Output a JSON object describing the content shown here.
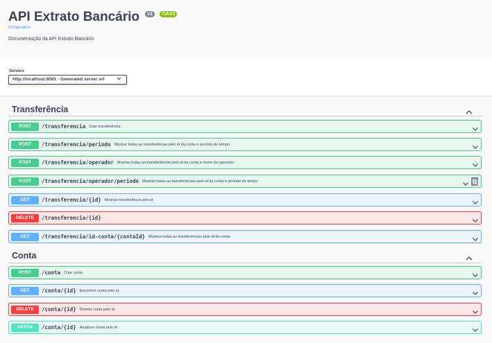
{
  "info": {
    "title": "API Extrato Bancário",
    "version_badge": "v1",
    "oas_badge": "OAS3",
    "docs_url": "/v3/api-docs",
    "description": "Documentação da API Extrato Bancário"
  },
  "servers": {
    "label": "Servers",
    "selected": "http://localhost:8081 - Generated server url"
  },
  "sections": [
    {
      "name": "Transferência",
      "operations": [
        {
          "method": "POST",
          "path": "/transferencia",
          "summary": "Criar transferência"
        },
        {
          "method": "POST",
          "path": "/transferencia/periodo",
          "summary": "Mostrar todas as transferências pelo id da conta e período de tempo"
        },
        {
          "method": "POST",
          "path": "/transferencia/operador",
          "summary": "Mostrar todas as transferências pelo id da conta e nome do operador"
        },
        {
          "method": "POST",
          "path": "/transferencia/operador/periodo",
          "summary": "Mostrar todas as transferências pelo id da conta e período de tempo"
        },
        {
          "method": "GET",
          "path": "/transferencia/{id}",
          "summary": "Mostrar transferência pelo id"
        },
        {
          "method": "DELETE",
          "path": "/transferencia/{id}",
          "summary": ""
        },
        {
          "method": "GET",
          "path": "/transferencia/id-conta/{contaId}",
          "summary": "Mostrar todas as transferências pelo id da conta"
        }
      ]
    },
    {
      "name": "Conta",
      "operations": [
        {
          "method": "POST",
          "path": "/conta",
          "summary": "Criar conta"
        },
        {
          "method": "GET",
          "path": "/conta/{id}",
          "summary": "Encontrar conta pelo id"
        },
        {
          "method": "DELETE",
          "path": "/conta/{id}",
          "summary": "Deletar conta pelo id"
        },
        {
          "method": "PATCH",
          "path": "/conta/{id}",
          "summary": "Atualizar conta pelo id"
        }
      ]
    }
  ],
  "colors": {
    "post": "#49cc90",
    "get": "#61affe",
    "delete": "#f93e3e",
    "patch": "#50e3c2"
  }
}
